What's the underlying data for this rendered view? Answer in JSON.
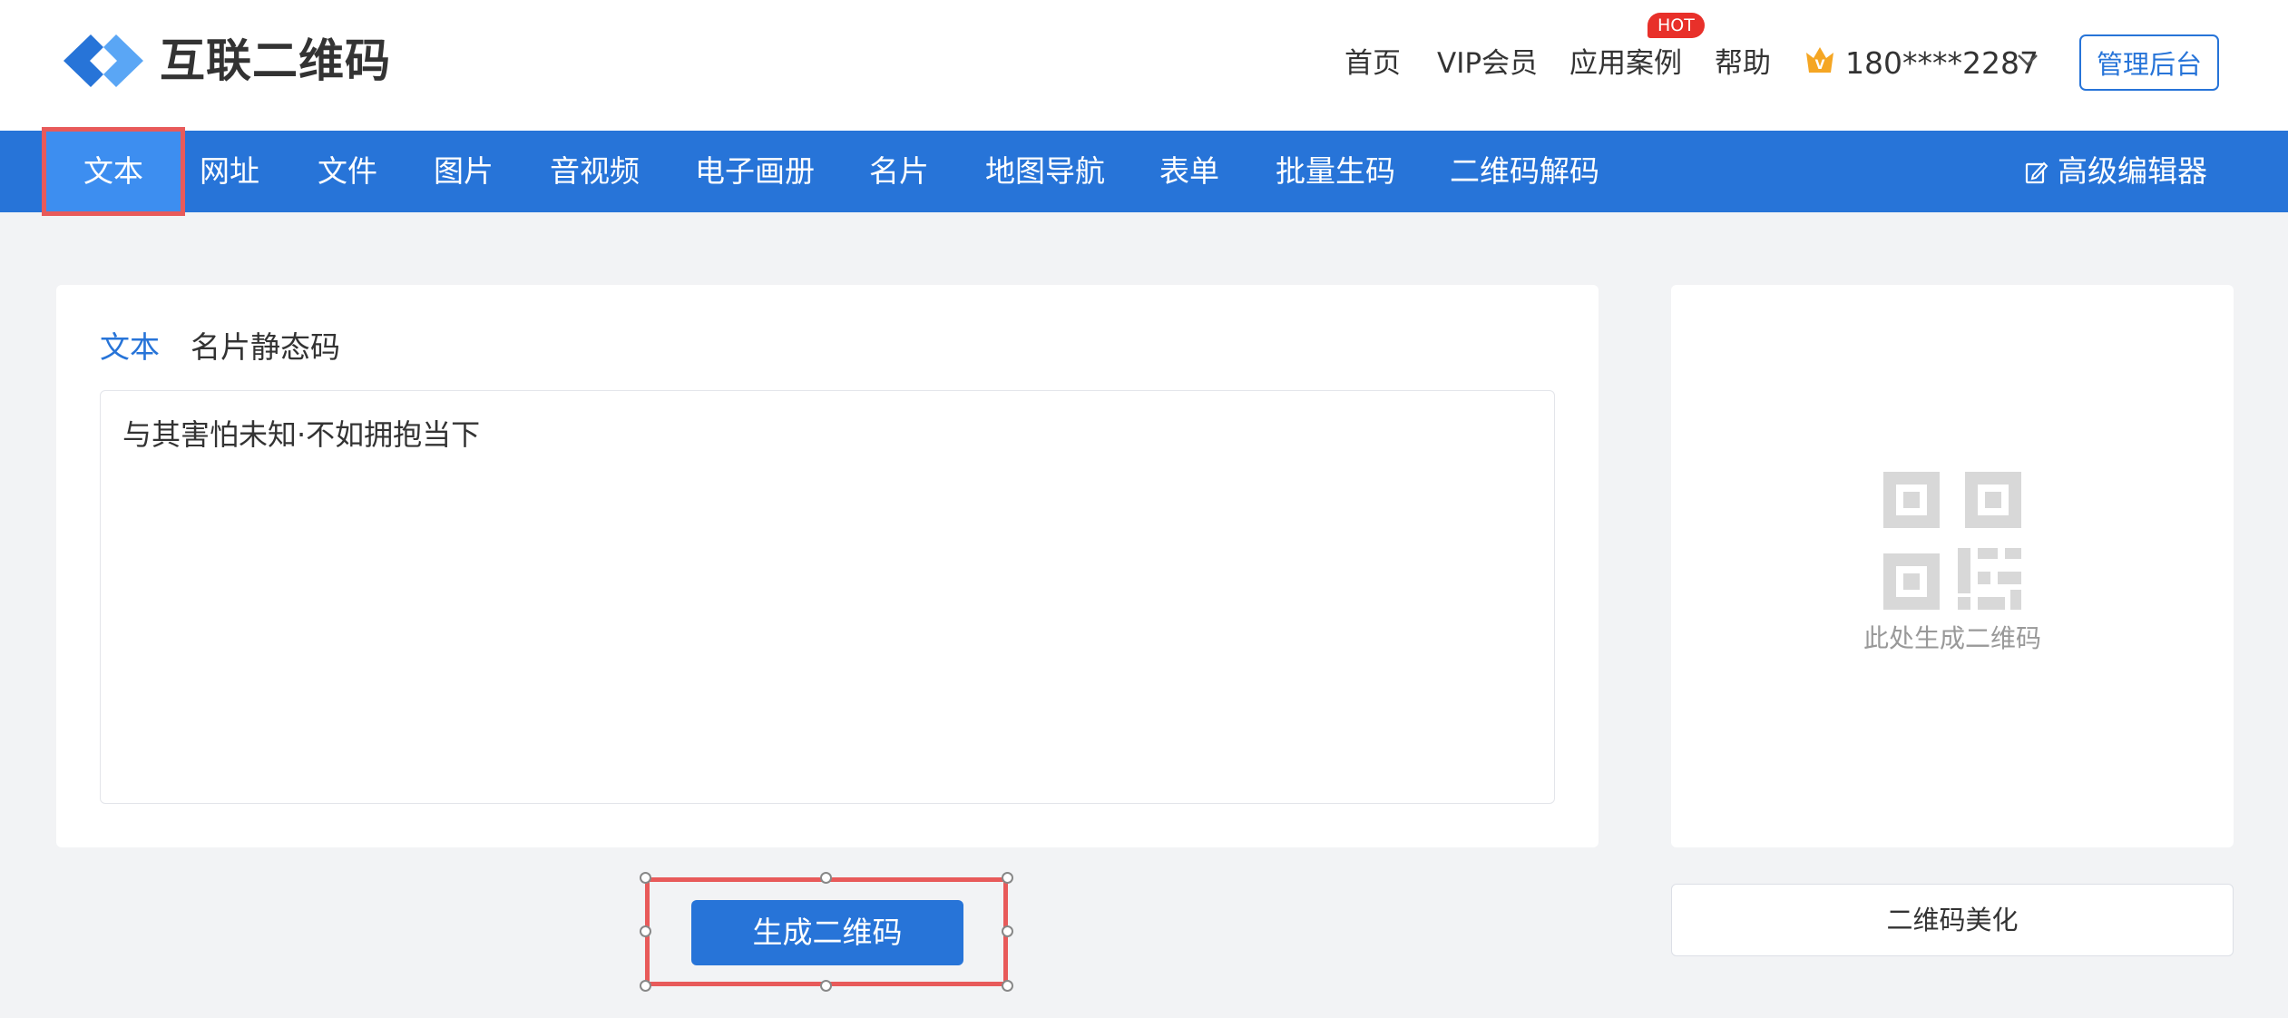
{
  "brand": {
    "name": "互联二维码"
  },
  "header": {
    "nav": [
      "首页",
      "VIP会员",
      "应用案例",
      "帮助"
    ],
    "hot_badge": "HOT",
    "user": "180****2287",
    "admin_button": "管理后台"
  },
  "navbar": {
    "active_tab": "文本",
    "tabs": [
      "网址",
      "文件",
      "图片",
      "音视频",
      "电子画册",
      "名片",
      "地图导航",
      "表单",
      "批量生码",
      "二维码解码"
    ],
    "advanced_editor": "高级编辑器"
  },
  "editor": {
    "subtabs": [
      "文本",
      "名片静态码"
    ],
    "text_value": "与其害怕未知·不如拥抱当下"
  },
  "actions": {
    "generate": "生成二维码"
  },
  "preview": {
    "placeholder": "此处生成二维码",
    "beautify": "二维码美化"
  },
  "colors": {
    "primary": "#2774d8",
    "active_tab": "#3d8ef0",
    "highlight": "#e85a5a",
    "hot": "#e8302a",
    "background": "#f2f3f5"
  }
}
